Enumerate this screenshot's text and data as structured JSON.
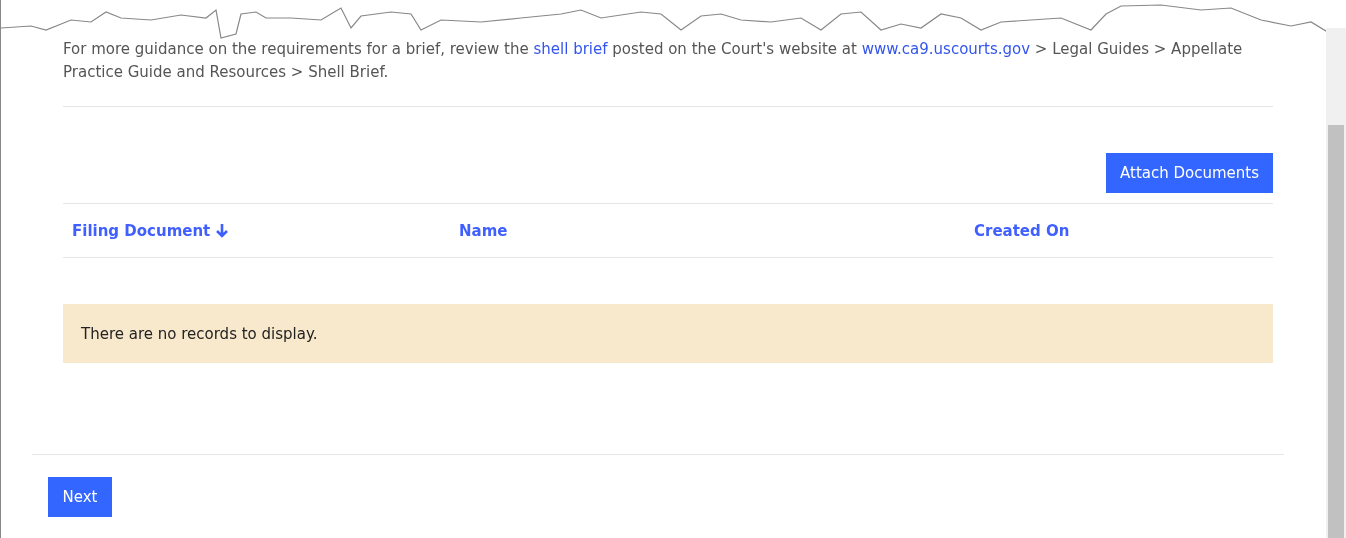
{
  "guidance": {
    "before": "For more guidance on the requirements for a brief, review the ",
    "link_1": "shell brief",
    "middle": " posted on the Court's website at ",
    "link_2": "www.ca9.uscourts.gov",
    "after": " > Legal Guides > Appellate Practice Guide and Resources > Shell Brief."
  },
  "attach_button": "Attach Documents",
  "table": {
    "columns": [
      {
        "label": "Filing Document",
        "sorted": true
      },
      {
        "label": "Name",
        "sorted": false
      },
      {
        "label": "Created On",
        "sorted": false
      }
    ],
    "empty_message": "There are no records to display."
  },
  "next_button": "Next"
}
